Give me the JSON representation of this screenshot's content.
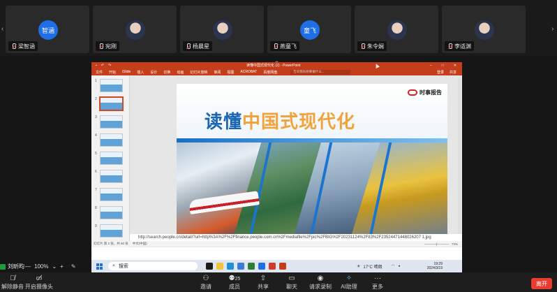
{
  "participants": [
    {
      "name": "梁智涵",
      "avatar_text": "智涵",
      "type": "initials"
    },
    {
      "name": "宛刚",
      "type": "photo"
    },
    {
      "name": "杨晨星",
      "type": "photo"
    },
    {
      "name": "燕童飞",
      "avatar_text": "童飞",
      "type": "initials"
    },
    {
      "name": "朱令娴",
      "type": "photo"
    },
    {
      "name": "李适渊",
      "type": "photo"
    }
  ],
  "shared_screen": {
    "window_title": "读懂中国式现代化 (2) - PowerPoint",
    "ribbon_tabs": [
      "文件",
      "开始",
      "iSlide",
      "插入",
      "设计",
      "切换",
      "动画",
      "幻灯片放映",
      "审阅",
      "视图",
      "ACROBAT",
      "百度网盘"
    ],
    "ribbon_search": "告诉我你想要做什么...",
    "ribbon_right": [
      "登录",
      "共享"
    ],
    "thumbnail_numbers": [
      "1",
      "2",
      "3",
      "4",
      "5",
      "6",
      "7",
      "8",
      "9"
    ],
    "selected_slide": 2,
    "slide": {
      "brand": "时事报告",
      "headline_part1": "读懂",
      "headline_part2": "中国式现代化"
    },
    "notes_text": "http://search.people.cn/detail/?url=http%3A%2F%2Ffinance.people.com.cn%2Fmediafile%2Fpic%2FBIG%2F20231124%2F83%2F23524471448026207 1.jpg",
    "status": {
      "slide_info": "幻灯片 第 2 张，共 60 张",
      "language": "中文(中国)",
      "zoom": "73%"
    },
    "taskbar": {
      "search_label": "搜索",
      "weather": "17°C 晴朗",
      "time": "19:29",
      "date": "2024/3/19"
    }
  },
  "speaker": {
    "name": "刘昕昀"
  },
  "zoom_level": "100%",
  "toolbar": {
    "items": [
      {
        "label": "解除静音",
        "icon": "mic-muted-icon"
      },
      {
        "label": "开启摄像头",
        "icon": "camera-off-icon"
      },
      {
        "label": "邀请",
        "icon": "invite-icon"
      },
      {
        "label": "成员",
        "icon": "members-icon",
        "badge": "25"
      },
      {
        "label": "共享",
        "icon": "share-icon"
      },
      {
        "label": "聊天",
        "icon": "chat-icon"
      },
      {
        "label": "请求录制",
        "icon": "record-icon"
      },
      {
        "label": "AI助理",
        "icon": "ai-assistant-icon"
      },
      {
        "label": "更多",
        "icon": "more-icon"
      }
    ],
    "leave_label": "离开"
  },
  "colors": {
    "ppt_accent": "#c43e1c",
    "avatar_blue": "#1e6fe6",
    "leave_red": "#ea3d2f"
  }
}
